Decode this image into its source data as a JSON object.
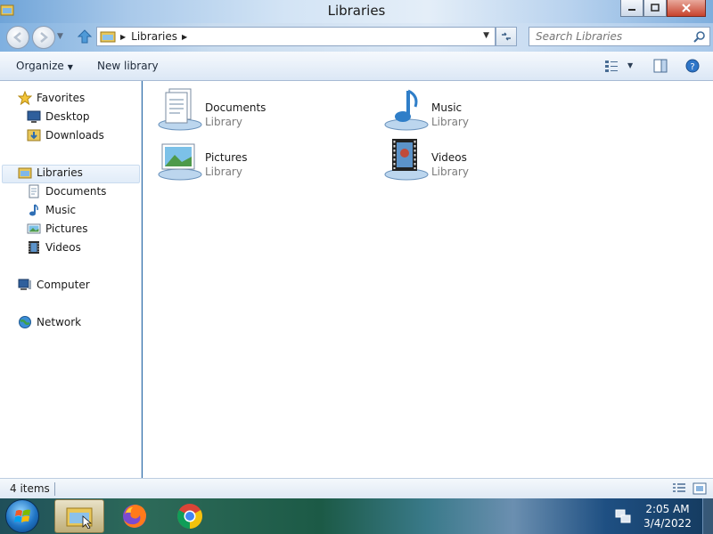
{
  "window": {
    "title": "Libraries",
    "minimize_symbol": "—",
    "maximize_symbol": "▫",
    "close_symbol": "✕"
  },
  "address": {
    "crumb": "Libraries",
    "search_placeholder": "Search Libraries"
  },
  "toolbar": {
    "organize_label": "Organize",
    "new_library_label": "New library"
  },
  "nav": {
    "favorites": {
      "label": "Favorites",
      "icon": "star-icon"
    },
    "favorites_items": [
      {
        "label": "Desktop",
        "icon": "desktop-icon"
      },
      {
        "label": "Downloads",
        "icon": "downloads-icon"
      }
    ],
    "libraries": {
      "label": "Libraries",
      "icon": "libraries-icon"
    },
    "libraries_items": [
      {
        "label": "Documents",
        "icon": "documents-icon"
      },
      {
        "label": "Music",
        "icon": "music-icon"
      },
      {
        "label": "Pictures",
        "icon": "pictures-icon"
      },
      {
        "label": "Videos",
        "icon": "videos-icon"
      }
    ],
    "computer": {
      "label": "Computer",
      "icon": "computer-icon"
    },
    "network": {
      "label": "Network",
      "icon": "network-icon"
    }
  },
  "content": {
    "items": [
      {
        "name": "Documents",
        "type": "Library",
        "icon": "documents-library-icon"
      },
      {
        "name": "Music",
        "type": "Library",
        "icon": "music-library-icon"
      },
      {
        "name": "Pictures",
        "type": "Library",
        "icon": "pictures-library-icon"
      },
      {
        "name": "Videos",
        "type": "Library",
        "icon": "videos-library-icon"
      }
    ]
  },
  "status": {
    "item_count": "4 items"
  },
  "taskbar": {
    "apps": [
      "Windows Explorer",
      "Firefox",
      "Chrome"
    ],
    "time": "2:05 AM",
    "date": "3/4/2022"
  },
  "colors": {
    "accent": "#2b6aa8",
    "selection": "#e1ecf8",
    "secondary_text": "#7b7b7b"
  }
}
